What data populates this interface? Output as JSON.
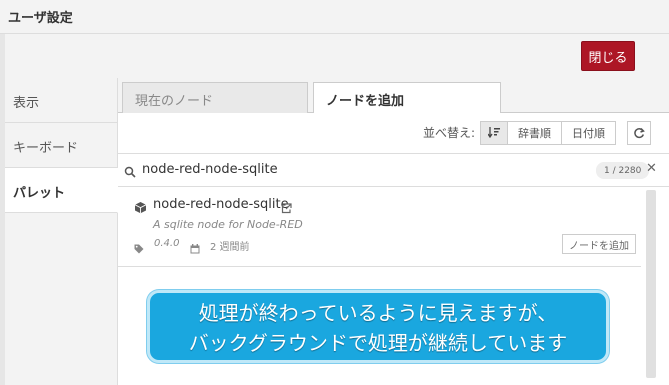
{
  "dialog": {
    "title": "ユーザ設定",
    "close_label": "閉じる"
  },
  "sidebar": {
    "items": [
      {
        "label": "表示"
      },
      {
        "label": "キーボード"
      },
      {
        "label": "パレット"
      }
    ],
    "active_index": 2
  },
  "tabs": [
    {
      "label": "現在のノード"
    },
    {
      "label": "ノードを追加"
    }
  ],
  "sort": {
    "label": "並べ替え:",
    "options": [
      "辞書順",
      "日付順"
    ],
    "selected": "relevance"
  },
  "search": {
    "query": "node-red-node-sqlite",
    "count": "1 / 2280"
  },
  "results": [
    {
      "name": "node-red-node-sqlite",
      "description": "A sqlite node for Node-RED",
      "version": "0.4.0",
      "updated": "2 週間前",
      "add_label": "ノードを追加"
    }
  ],
  "annotation": {
    "line1": "処理が終わっているように見えますが、",
    "line2": "バックグラウンドで処理が継続しています"
  },
  "colors": {
    "accent": "#ad1625",
    "callout": "#1aa7df"
  }
}
